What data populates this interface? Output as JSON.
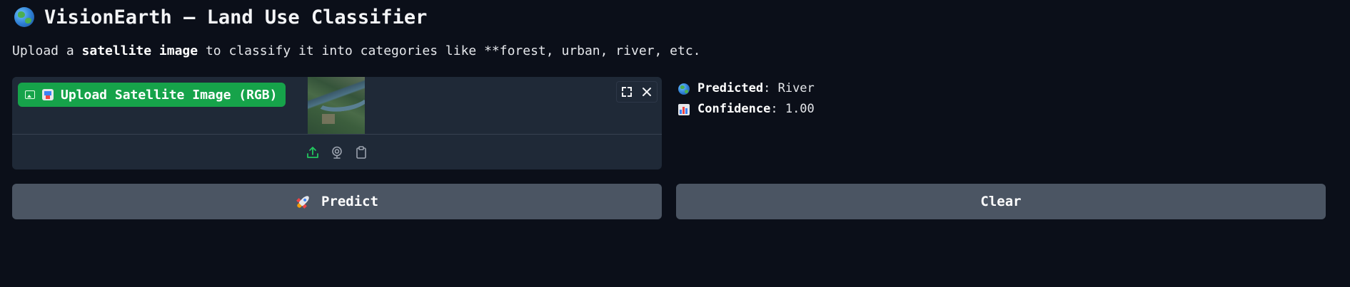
{
  "app": {
    "title": "VisionEarth — Land Use Classifier",
    "description_prefix": "Upload a ",
    "description_bold": "satellite image",
    "description_suffix": " to classify it into categories like **forest, urban, river, etc."
  },
  "upload": {
    "label": "Upload Satellite Image (RGB)",
    "source_icons": [
      "upload-icon",
      "webcam-icon",
      "clipboard-icon"
    ],
    "accent_color": "#16a34a"
  },
  "result": {
    "predicted_label": "Predicted",
    "predicted_value": ": River",
    "confidence_label": "Confidence",
    "confidence_value": ": 1.00"
  },
  "actions": {
    "predict_label": "Predict",
    "clear_label": "Clear"
  },
  "colors": {
    "background": "#0b0f19",
    "panel": "#1f2937",
    "button": "#4b5563"
  }
}
